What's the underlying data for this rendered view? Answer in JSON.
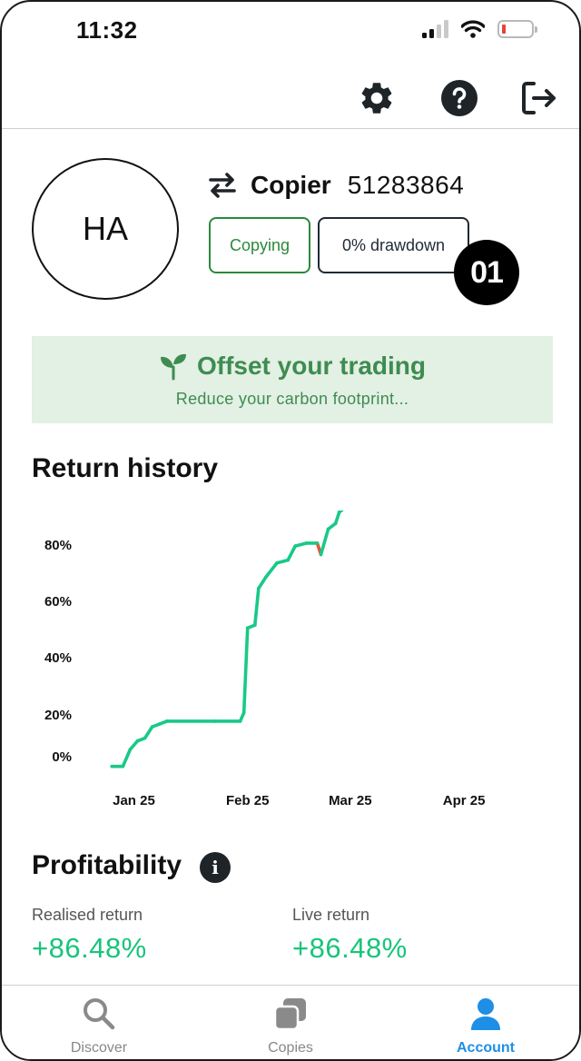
{
  "status_bar": {
    "time": "11:32"
  },
  "toolbar": {
    "icons": [
      "gear-icon",
      "help-icon",
      "logout-icon"
    ]
  },
  "profile": {
    "initials": "HA",
    "type_label": "Copier",
    "account_id": "51283864",
    "status_pill": "Copying",
    "drawdown_pill": "0% drawdown",
    "step_badge": "01",
    "colors": {
      "copying": "#2a8a3a",
      "drawdown": "#1f2a36"
    }
  },
  "offset_banner": {
    "title": "Offset your trading",
    "subtitle": "Reduce your carbon footprint...",
    "background": "#e3f0e4",
    "accent": "#3e8c51"
  },
  "return_history": {
    "title": "Return history"
  },
  "chart_data": {
    "type": "line",
    "title": "Return history",
    "xlabel": "",
    "ylabel": "",
    "x_ticks": [
      "Jan 25",
      "Feb 25",
      "Mar 25",
      "Apr 25"
    ],
    "y_ticks": [
      "0%",
      "20%",
      "40%",
      "60%",
      "80%"
    ],
    "ylim": [
      0,
      90
    ],
    "grid": false,
    "colors": {
      "positive": "#19c987",
      "negative": "#e0553a"
    },
    "series": [
      {
        "values": [
          {
            "x": "2025-01-07",
            "y": -6
          },
          {
            "x": "2025-01-10",
            "y": -6
          },
          {
            "x": "2025-01-12",
            "y": 0
          },
          {
            "x": "2025-01-14",
            "y": 3
          },
          {
            "x": "2025-01-16",
            "y": 4
          },
          {
            "x": "2025-01-18",
            "y": 8
          },
          {
            "x": "2025-01-20",
            "y": 9
          },
          {
            "x": "2025-01-22",
            "y": 10
          },
          {
            "x": "2025-02-04",
            "y": 10
          },
          {
            "x": "2025-02-11",
            "y": 10
          },
          {
            "x": "2025-02-12",
            "y": 13
          },
          {
            "x": "2025-02-13",
            "y": 43
          },
          {
            "x": "2025-02-15",
            "y": 44
          },
          {
            "x": "2025-02-16",
            "y": 57
          },
          {
            "x": "2025-02-18",
            "y": 61
          },
          {
            "x": "2025-02-21",
            "y": 66
          },
          {
            "x": "2025-02-24",
            "y": 67
          },
          {
            "x": "2025-02-26",
            "y": 72
          },
          {
            "x": "2025-03-01",
            "y": 73
          },
          {
            "x": "2025-03-04",
            "y": 73
          },
          {
            "x": "2025-03-05",
            "y": 69
          },
          {
            "x": "2025-03-07",
            "y": 78
          },
          {
            "x": "2025-03-09",
            "y": 80
          },
          {
            "x": "2025-03-10",
            "y": 84
          },
          {
            "x": "2025-03-12",
            "y": 86
          },
          {
            "x": "2025-05-05",
            "y": 86
          }
        ]
      }
    ]
  },
  "profitability": {
    "title": "Profitability",
    "realised_label": "Realised return",
    "realised_value": "+86.48%",
    "live_label": "Live return",
    "live_value": "+86.48%",
    "value_color": "#17c57a"
  },
  "bottom_nav": {
    "items": [
      {
        "label": "Discover",
        "icon": "search-icon",
        "active": false
      },
      {
        "label": "Copies",
        "icon": "copies-icon",
        "active": false
      },
      {
        "label": "Account",
        "icon": "person-icon",
        "active": true
      }
    ],
    "active_color": "#1e8ee6"
  }
}
